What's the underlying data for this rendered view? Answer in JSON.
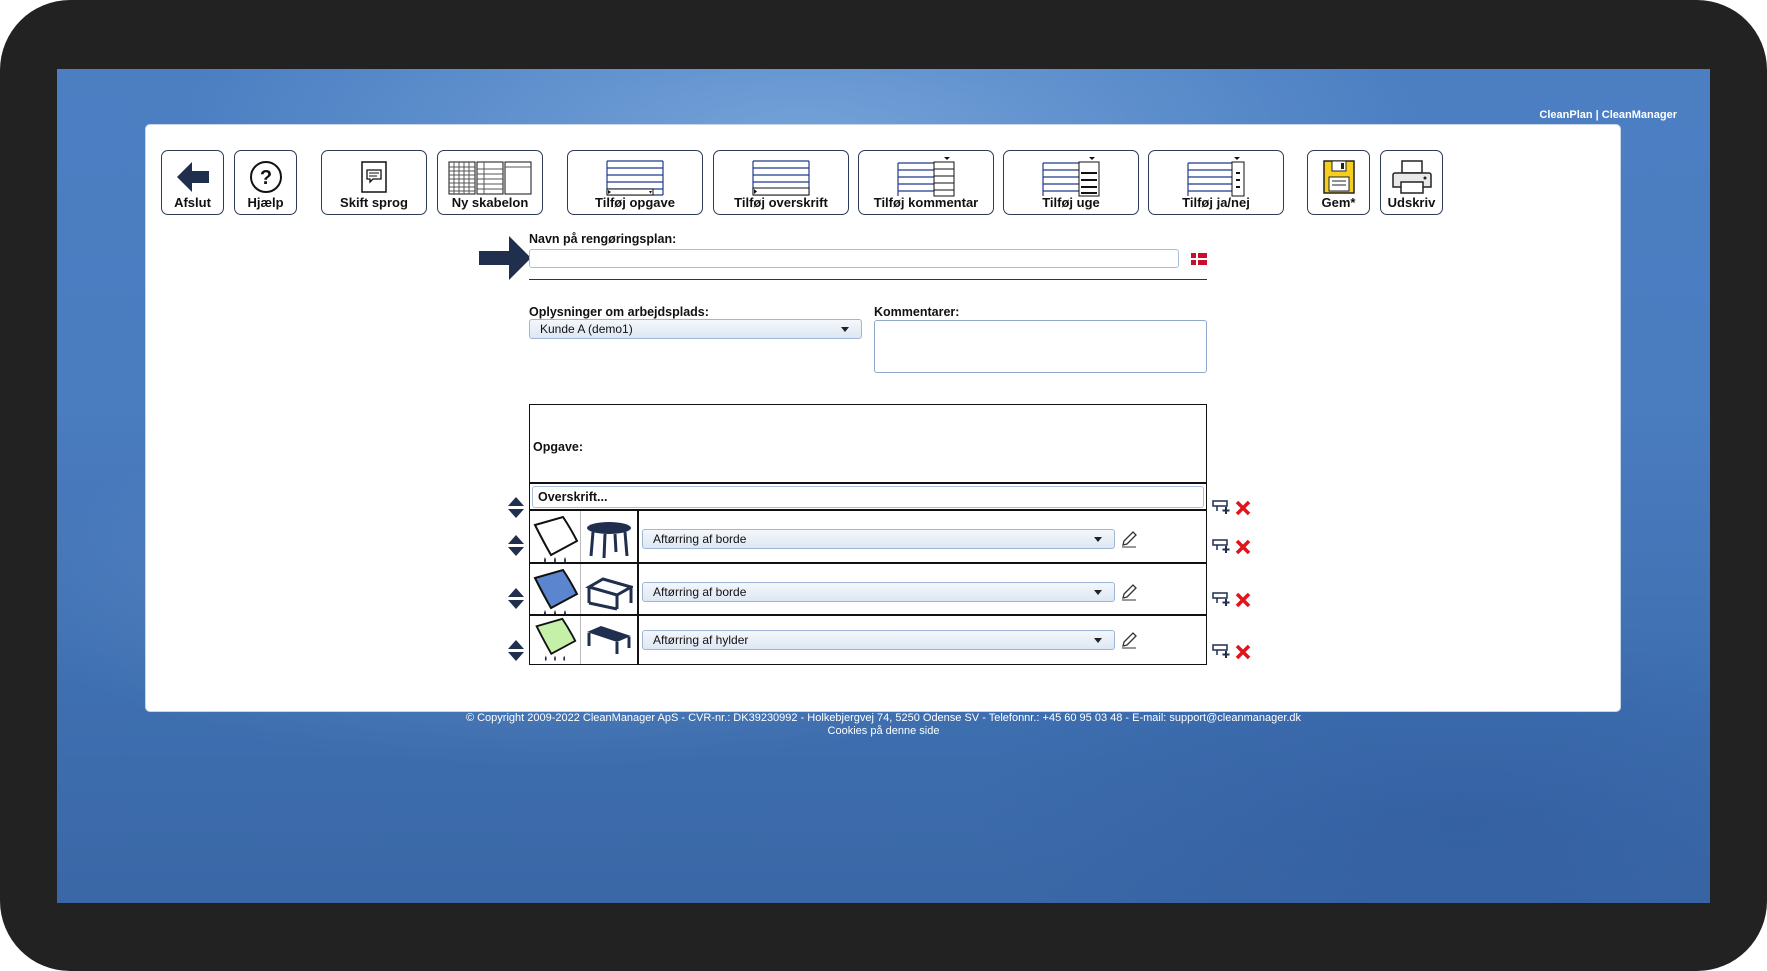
{
  "brand": "CleanPlan | CleanManager",
  "toolbar": [
    {
      "label": "Afslut",
      "icon": "arrow-left-icon"
    },
    {
      "label": "Hjælp",
      "icon": "help-icon"
    },
    {
      "label": "Skift sprog",
      "icon": "language-icon"
    },
    {
      "label": "Ny skabelon",
      "icon": "template-icon"
    },
    {
      "label": "Tilføj opgave",
      "icon": "add-task-icon"
    },
    {
      "label": "Tilføj overskrift",
      "icon": "add-heading-icon"
    },
    {
      "label": "Tilføj kommentar",
      "icon": "add-comment-icon"
    },
    {
      "label": "Tilføj uge",
      "icon": "add-week-icon"
    },
    {
      "label": "Tilføj ja/nej",
      "icon": "add-yes-no-icon"
    },
    {
      "label": "Gem*",
      "icon": "save-icon"
    },
    {
      "label": "Udskriv",
      "icon": "print-icon"
    }
  ],
  "form": {
    "name_label": "Navn på rengøringsplan:",
    "name_value": "",
    "workplace_label": "Oplysninger om arbejdsplads:",
    "workplace_value": "Kunde A (demo1)",
    "comments_label": "Kommentarer:",
    "comments_value": ""
  },
  "table": {
    "header": "Opgave:",
    "heading_row": "Overskrift...",
    "tasks": [
      {
        "value": "Aftørring af borde",
        "cloth_color": "#ffffff",
        "item": "round-table"
      },
      {
        "value": "Aftørring af borde",
        "cloth_color": "#5b86cf",
        "item": "desk"
      },
      {
        "value": "Aftørring af hylder",
        "cloth_color": "#c4f0a8",
        "item": "shelf"
      }
    ]
  },
  "footer": {
    "copyright": "© Copyright 2009-2022 CleanManager ApS - CVR-nr.: DK39230992 - Holkebjergvej 74, 5250 Odense SV - Telefonnr.: +45 60 95 03 48 - E-mail: support@cleanmanager.dk",
    "cookies": "Cookies på denne side"
  },
  "colors": {
    "accent": "#1f2f4d",
    "delete": "#e0141b",
    "flag": "#c8102e"
  }
}
